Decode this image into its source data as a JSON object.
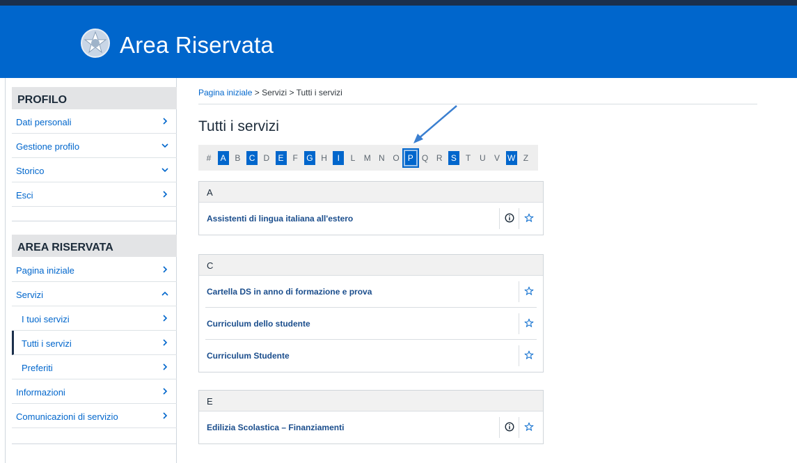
{
  "header": {
    "title": "Area Riservata"
  },
  "sidebar": {
    "profilo": {
      "title": "PROFILO",
      "items": [
        {
          "label": "Dati personali",
          "chevron": "right"
        },
        {
          "label": "Gestione profilo",
          "chevron": "down"
        },
        {
          "label": "Storico",
          "chevron": "down"
        },
        {
          "label": "Esci",
          "chevron": "right"
        }
      ]
    },
    "area": {
      "title": "AREA RISERVATA",
      "items": [
        {
          "label": "Pagina iniziale",
          "chevron": "right"
        },
        {
          "label": "Servizi",
          "chevron": "up"
        },
        {
          "label": "I tuoi servizi",
          "chevron": "right"
        },
        {
          "label": "Tutti i servizi",
          "chevron": "right"
        },
        {
          "label": "Preferiti",
          "chevron": "right"
        },
        {
          "label": "Informazioni",
          "chevron": "right"
        },
        {
          "label": "Comunicazioni di servizio",
          "chevron": "right"
        }
      ]
    }
  },
  "breadcrumb": {
    "home": "Pagina iniziale",
    "sep": ">",
    "services": "Servizi",
    "current": "Tutti i servizi"
  },
  "main": {
    "title": "Tutti i servizi",
    "letters": [
      "#",
      "A",
      "B",
      "C",
      "D",
      "E",
      "F",
      "G",
      "H",
      "I",
      "L",
      "M",
      "N",
      "O",
      "P",
      "Q",
      "R",
      "S",
      "T",
      "U",
      "V",
      "W",
      "Z"
    ],
    "active_letters": [
      "A",
      "C",
      "E",
      "G",
      "I",
      "P",
      "S",
      "W"
    ],
    "highlighted_letter": "P",
    "groups": [
      {
        "letter": "A",
        "items": [
          {
            "label": "Assistenti di lingua italiana all'estero",
            "info": true
          }
        ]
      },
      {
        "letter": "C",
        "items": [
          {
            "label": "Cartella DS in anno di formazione e prova",
            "info": false
          },
          {
            "label": "Curriculum dello studente",
            "info": false
          },
          {
            "label": "Curriculum Studente",
            "info": false
          }
        ]
      },
      {
        "letter": "E",
        "items": [
          {
            "label": "Edilizia Scolastica – Finanziamenti",
            "info": true
          }
        ]
      }
    ]
  },
  "colors": {
    "primary": "#0066cc",
    "dark": "#1b2f4b"
  }
}
